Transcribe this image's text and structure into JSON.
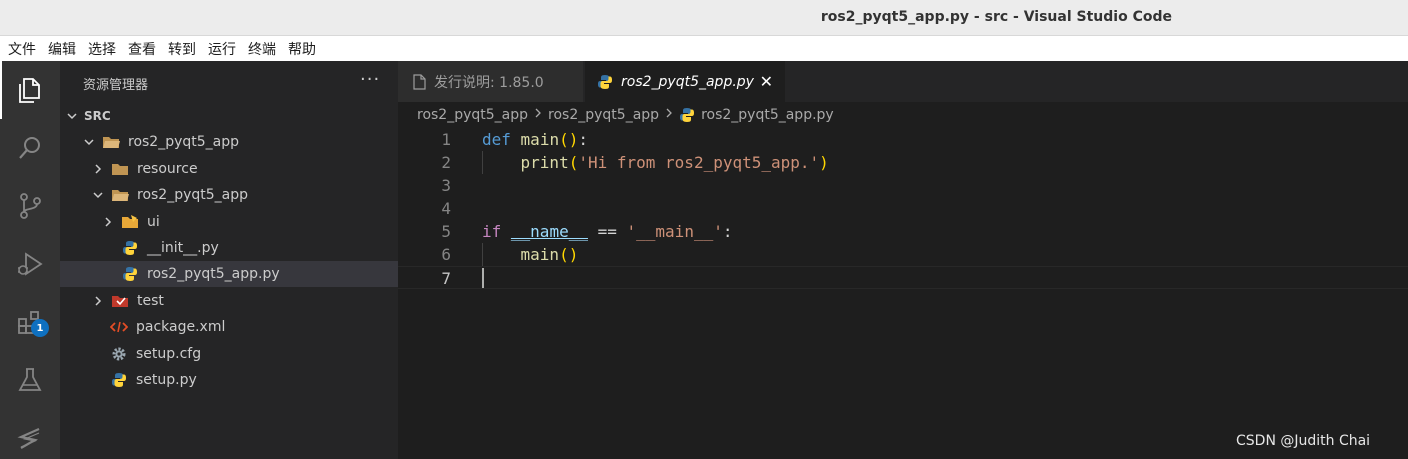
{
  "window": {
    "title": "ros2_pyqt5_app.py - src - Visual Studio Code"
  },
  "menu": [
    "文件",
    "编辑",
    "选择",
    "查看",
    "转到",
    "运行",
    "终端",
    "帮助"
  ],
  "activity": {
    "icons": [
      "explorer-icon",
      "search-icon",
      "source-control-icon",
      "run-debug-icon",
      "extensions-icon",
      "testing-icon",
      "ros-icon"
    ],
    "extensions_badge": "1"
  },
  "explorer": {
    "title": "资源管理器",
    "more": "···",
    "root": "SRC",
    "items": [
      {
        "label": "ros2_pyqt5_app",
        "type": "folder-open"
      },
      {
        "label": "resource",
        "type": "folder"
      },
      {
        "label": "ros2_pyqt5_app",
        "type": "folder-open"
      },
      {
        "label": "ui",
        "type": "folder-ui"
      },
      {
        "label": "__init__.py",
        "type": "python"
      },
      {
        "label": "ros2_pyqt5_app.py",
        "type": "python"
      },
      {
        "label": "test",
        "type": "folder-test"
      },
      {
        "label": "package.xml",
        "type": "xml"
      },
      {
        "label": "setup.cfg",
        "type": "config"
      },
      {
        "label": "setup.py",
        "type": "python"
      }
    ]
  },
  "tabs": [
    {
      "label": "发行说明: 1.85.0"
    },
    {
      "label": "ros2_pyqt5_app.py",
      "close": "✕"
    }
  ],
  "breadcrumb": [
    "ros2_pyqt5_app",
    "ros2_pyqt5_app",
    "ros2_pyqt5_app.py"
  ],
  "editor": {
    "line_numbers": [
      "1",
      "2",
      "3",
      "4",
      "5",
      "6",
      "7"
    ],
    "code": {
      "l1_def": "def",
      "l1_main": "main",
      "l1_open": "(",
      "l1_close": ")",
      "l1_colon": ":",
      "l2_print": "print",
      "l2_open": "(",
      "l2_str": "'Hi from ros2_pyqt5_app.'",
      "l2_close": ")",
      "l5_if": "if",
      "l5_name": "__name__",
      "l5_eq": "==",
      "l5_str": "'__main__'",
      "l5_colon": ":",
      "l6_main": "main",
      "l6_open": "(",
      "l6_close": ")"
    }
  },
  "watermark": "CSDN @Judith Chai",
  "colors": {
    "keyword": "#569cd6",
    "control_keyword": "#c586c0",
    "function": "#dcdcaa",
    "string": "#ce9178",
    "variable": "#9cdcfe",
    "bracket": "#ffd700",
    "folder": "#c09553",
    "python_blue": "#3572a5",
    "python_yellow": "#ffd43b"
  }
}
